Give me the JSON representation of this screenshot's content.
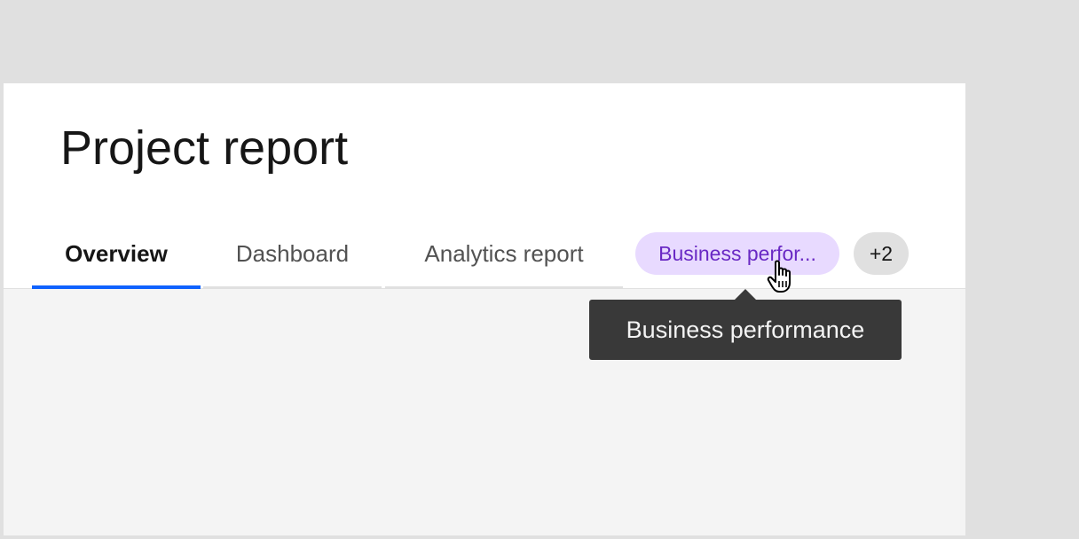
{
  "page": {
    "title": "Project report"
  },
  "tabs": [
    {
      "label": "Overview",
      "selected": true
    },
    {
      "label": "Dashboard",
      "selected": false
    },
    {
      "label": "Analytics report",
      "selected": false
    }
  ],
  "tags": {
    "overflow_tag_label": "Business perfor...",
    "count_label": "+2"
  },
  "tooltip": {
    "text": "Business performance"
  },
  "icons": {
    "cursor": "hand-pointer-icon"
  },
  "colors": {
    "selected_tab_underline": "#0f62fe",
    "tag_purple_bg": "#e8daff",
    "tag_purple_text": "#6929c4",
    "tooltip_bg": "#393939"
  }
}
